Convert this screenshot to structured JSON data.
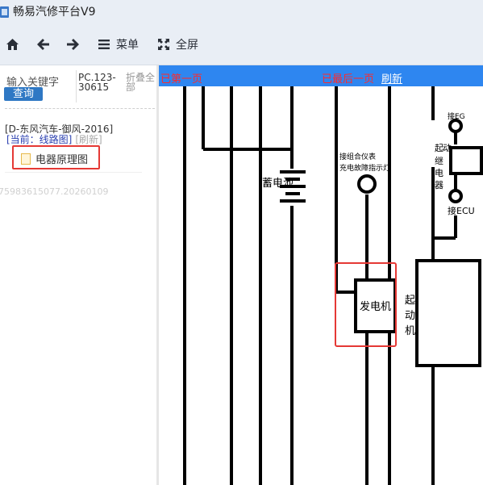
{
  "window": {
    "title": "畅易汽修平台V9"
  },
  "toolbar": {
    "menu_label": "菜单",
    "fullscreen_label": "全屏"
  },
  "search": {
    "keyword_label": "输入关键字",
    "query_button": "查询",
    "pc_code": "PC.123-30615",
    "collapse_all": "折叠全部"
  },
  "tree": {
    "model": "[D-东风汽车-御风-2016]",
    "current": "[当前：线路图]",
    "refresh": "[刷新]",
    "item_label": "电器原理图",
    "footer_id": "75983615077.20260109"
  },
  "diagram": {
    "first_page": "已第一页",
    "last_page": "已最后一页",
    "refresh": "刷新",
    "labels": {
      "battery": "蓄电池",
      "indicator_line1": "接组合仪表",
      "indicator_line2": "充电故障指示灯",
      "generator": "发电机",
      "starter_col1": "起",
      "starter_col2": "动",
      "starter_col3": "机",
      "relay_top": "接EG",
      "relay_char1": "起",
      "relay_char2": "动",
      "relay_char3": "继",
      "relay_char4": "电",
      "relay_char5": "器",
      "relay_bottom": "接ECU"
    }
  },
  "colors": {
    "header_blue": "#2e86f0",
    "page_notice_red": "#ff2a2a",
    "highlight_red": "#e53935",
    "query_button_blue": "#2f78c4"
  }
}
